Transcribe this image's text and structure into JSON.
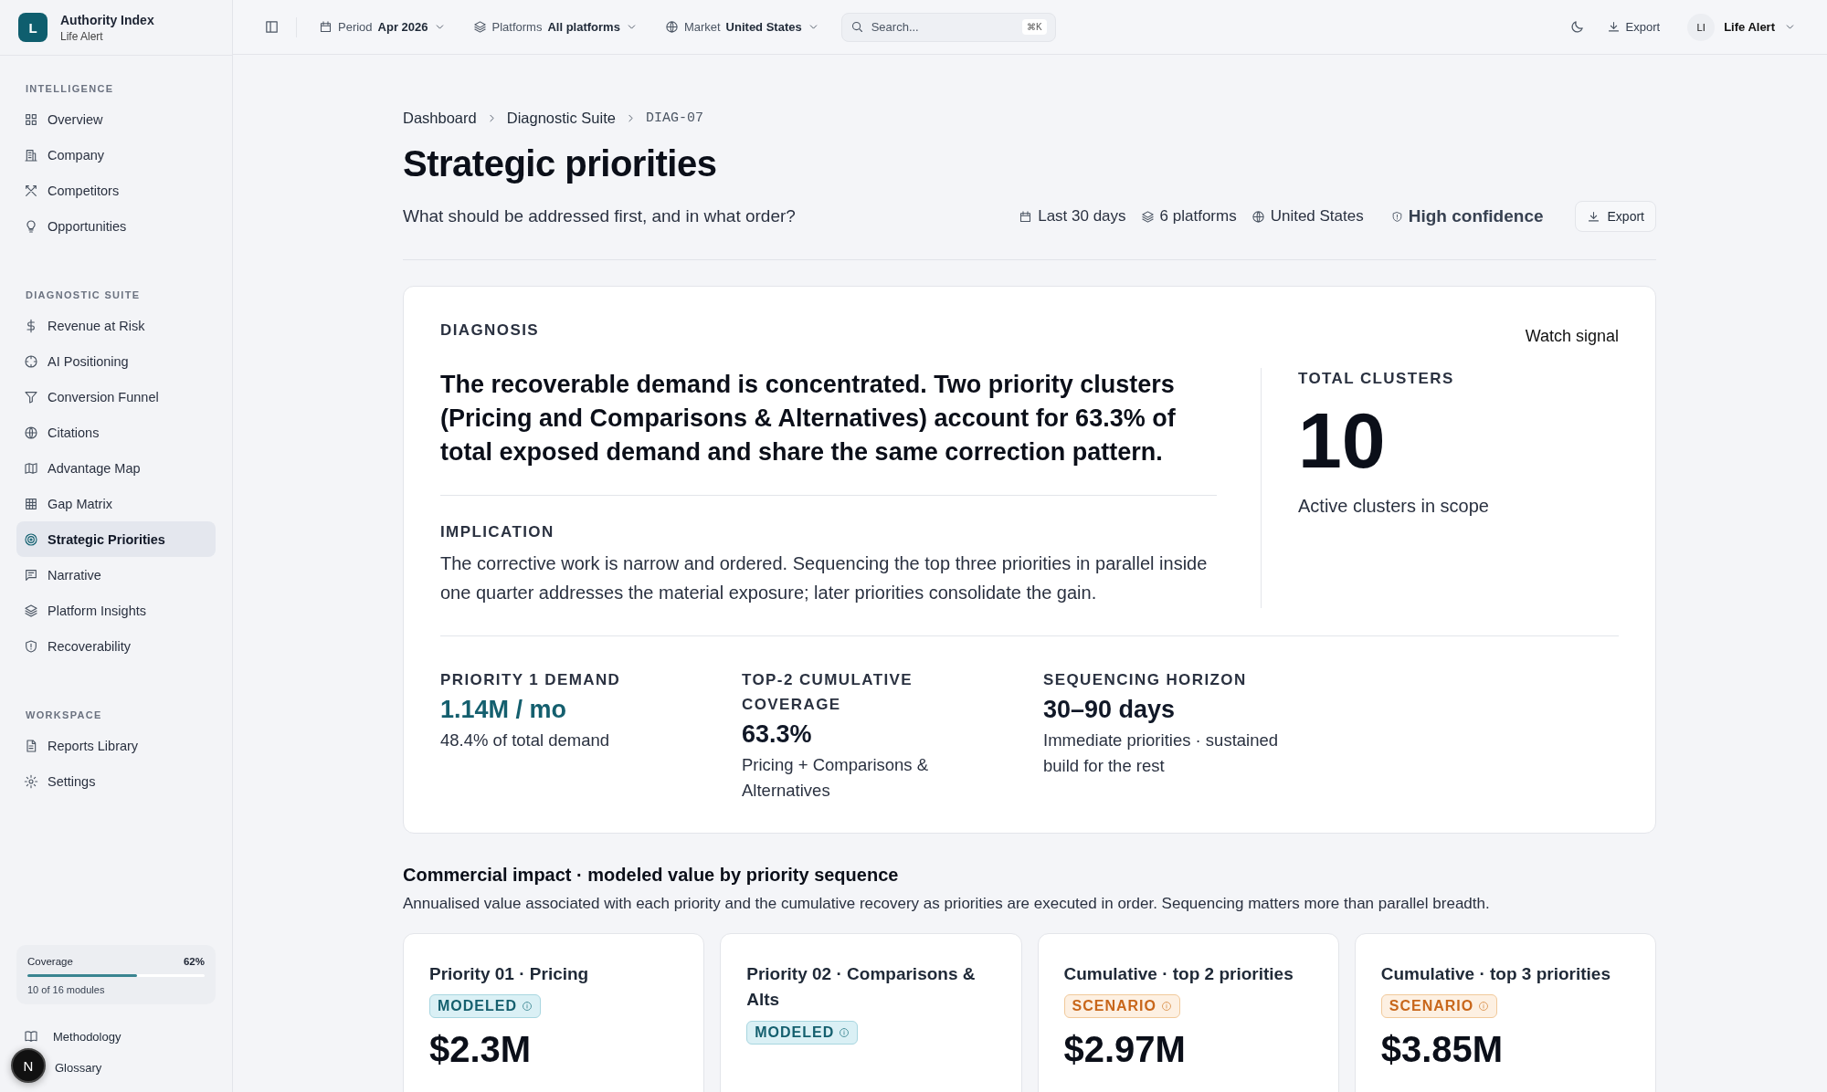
{
  "brand": {
    "logo": "L",
    "name": "Authority Index",
    "client": "Life Alert"
  },
  "sidebar": {
    "sections": [
      {
        "title": "INTELLIGENCE",
        "items": [
          {
            "label": "Overview",
            "selected": false
          },
          {
            "label": "Company",
            "selected": false
          },
          {
            "label": "Competitors",
            "selected": false
          },
          {
            "label": "Opportunities",
            "selected": false
          }
        ]
      },
      {
        "title": "DIAGNOSTIC SUITE",
        "items": [
          {
            "label": "Revenue at Risk",
            "selected": false
          },
          {
            "label": "AI Positioning",
            "selected": false
          },
          {
            "label": "Conversion Funnel",
            "selected": false
          },
          {
            "label": "Citations",
            "selected": false
          },
          {
            "label": "Advantage Map",
            "selected": false
          },
          {
            "label": "Gap Matrix",
            "selected": false
          },
          {
            "label": "Strategic Priorities",
            "selected": true
          },
          {
            "label": "Narrative",
            "selected": false
          },
          {
            "label": "Platform Insights",
            "selected": false
          },
          {
            "label": "Recoverability",
            "selected": false
          }
        ]
      },
      {
        "title": "WORKSPACE",
        "items": [
          {
            "label": "Reports Library",
            "selected": false
          },
          {
            "label": "Settings",
            "selected": false
          }
        ]
      }
    ],
    "coverage": {
      "label": "Coverage",
      "value": "62%",
      "level": 0.62,
      "note": "10 of 16 modules"
    },
    "footer_links": [
      "Methodology",
      "Glossary"
    ],
    "dev_badge": "N"
  },
  "topbar": {
    "filters": [
      {
        "label": "Period",
        "value": "Apr 2026"
      },
      {
        "label": "Platforms",
        "value": "All platforms"
      },
      {
        "label": "Market",
        "value": "United States"
      }
    ],
    "search": {
      "placeholder": "Search...",
      "shortcut": "⌘K"
    },
    "export": "Export",
    "user": {
      "initials": "LI",
      "name": "Life Alert"
    }
  },
  "breadcrumb": [
    "Dashboard",
    "Diagnostic Suite",
    "DIAG-07"
  ],
  "title": "Strategic priorities",
  "subtitle": "What should be addressed first, and in what order?",
  "meta": [
    "Last 30 days",
    "6 platforms",
    "United States"
  ],
  "confidence": "High confidence",
  "export": "Export",
  "diagnosis": {
    "label": "DIAGNOSIS",
    "watch": "Watch signal",
    "headline": "The recoverable demand is concentrated. Two priority clusters (Pricing and Comparisons & Alternatives) account for 63.3% of total exposed demand and share the same correction pattern.",
    "implication_label": "IMPLICATION",
    "implication": "The corrective work is narrow and ordered. Sequencing the top three priorities in parallel inside one quarter addresses the material exposure; later priorities consolidate the gain.",
    "total": {
      "label": "TOTAL CLUSTERS",
      "value": "10",
      "note": "Active clusters in scope"
    },
    "metrics": [
      {
        "label": "PRIORITY 1 DEMAND",
        "value": "1.14M / mo",
        "note": "48.4% of total demand",
        "highlighted": true
      },
      {
        "label": "TOP-2 CUMULATIVE COVERAGE",
        "value": "63.3%",
        "note": "Pricing + Comparisons & Alternatives",
        "highlighted": false
      },
      {
        "label": "SEQUENCING HORIZON",
        "value": "30–90 days",
        "note": "Immediate priorities · sustained build for the rest",
        "highlighted": false
      }
    ]
  },
  "impact": {
    "title": "Commercial impact · modeled value by priority sequence",
    "description": "Annualised value associated with each priority and the cumulative recovery as priorities are executed in order. Sequencing matters more than parallel breadth.",
    "cards": [
      {
        "title": "Priority 01 · Pricing",
        "badge": "MODELED",
        "kind": "modeled",
        "value": "$2.3M"
      },
      {
        "title": "Priority 02 · Comparisons & Alts",
        "badge": "MODELED",
        "kind": "modeled"
      },
      {
        "title": "Cumulative · top 2 priorities",
        "badge": "SCENARIO",
        "kind": "scenario",
        "value": "$2.97M"
      },
      {
        "title": "Cumulative · top 3 priorities",
        "badge": "SCENARIO",
        "kind": "scenario",
        "value": "$3.85M"
      }
    ]
  }
}
